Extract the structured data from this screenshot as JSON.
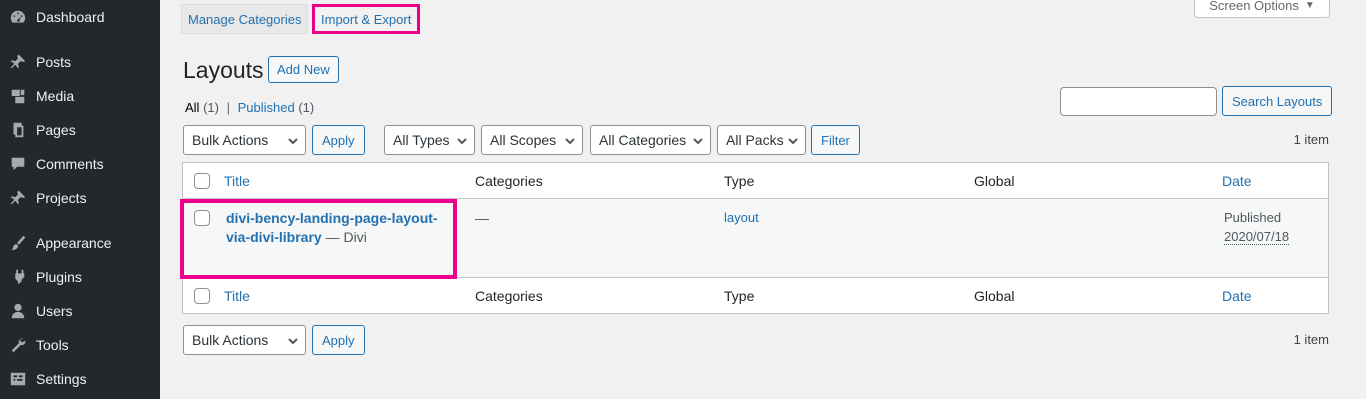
{
  "sidebar": {
    "items": [
      {
        "label": "Dashboard",
        "icon": "dashboard-icon"
      },
      {
        "label": "Posts",
        "icon": "pin-icon"
      },
      {
        "label": "Media",
        "icon": "media-icon"
      },
      {
        "label": "Pages",
        "icon": "pages-icon"
      },
      {
        "label": "Comments",
        "icon": "comment-icon"
      },
      {
        "label": "Projects",
        "icon": "pin-icon"
      },
      {
        "label": "Appearance",
        "icon": "brush-icon"
      },
      {
        "label": "Plugins",
        "icon": "plugin-icon"
      },
      {
        "label": "Users",
        "icon": "user-icon"
      },
      {
        "label": "Tools",
        "icon": "wrench-icon"
      },
      {
        "label": "Settings",
        "icon": "settings-icon"
      }
    ]
  },
  "tabs": {
    "manage": "Manage Categories",
    "import": "Import & Export"
  },
  "screen_options": {
    "label": "Screen Options",
    "arrow": "▼"
  },
  "header": {
    "title": "Layouts",
    "add_new": "Add New"
  },
  "views": {
    "all": "All",
    "all_count": "(1)",
    "sep": "|",
    "published": "Published",
    "published_count": "(1)"
  },
  "search": {
    "button": "Search Layouts",
    "value": ""
  },
  "filters": {
    "bulk": "Bulk Actions",
    "apply": "Apply",
    "types": "All Types",
    "scopes": "All Scopes",
    "categories": "All Categories",
    "packs": "All Packs",
    "filter": "Filter"
  },
  "items_count": "1 item",
  "table": {
    "headers": {
      "title": "Title",
      "categories": "Categories",
      "type": "Type",
      "global": "Global",
      "date": "Date"
    },
    "rows": [
      {
        "title": "divi-bency-landing-page-layout-via-divi-library",
        "suffix": "— Divi",
        "categories": "—",
        "type": "layout",
        "global": "",
        "date_status": "Published",
        "date": "2020/07/18"
      }
    ]
  },
  "colors": {
    "accent": "#2271b1",
    "highlight": "#ec008c",
    "sidebar": "#23282d"
  }
}
